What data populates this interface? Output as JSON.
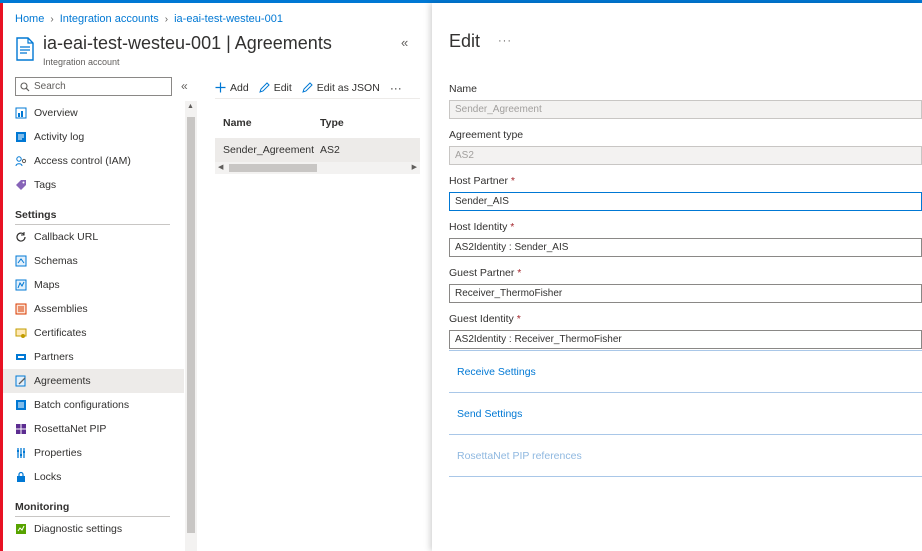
{
  "breadcrumb": [
    "Home",
    "Integration accounts",
    "ia-eai-test-westeu-001"
  ],
  "header": {
    "title": "ia-eai-test-westeu-001 | Agreements",
    "subtitle": "Integration account"
  },
  "search": {
    "placeholder": "Search"
  },
  "menu": {
    "top_items": [
      {
        "label": "Overview",
        "icon": "overview-icon"
      },
      {
        "label": "Activity log",
        "icon": "activity-log-icon"
      },
      {
        "label": "Access control (IAM)",
        "icon": "people-icon"
      },
      {
        "label": "Tags",
        "icon": "tag-icon"
      }
    ],
    "settings_title": "Settings",
    "settings_items": [
      {
        "label": "Callback URL",
        "icon": "refresh-icon"
      },
      {
        "label": "Schemas",
        "icon": "schema-icon"
      },
      {
        "label": "Maps",
        "icon": "map-icon"
      },
      {
        "label": "Assemblies",
        "icon": "assembly-icon"
      },
      {
        "label": "Certificates",
        "icon": "certificate-icon"
      },
      {
        "label": "Partners",
        "icon": "partner-icon"
      },
      {
        "label": "Agreements",
        "icon": "agreement-icon"
      },
      {
        "label": "Batch configurations",
        "icon": "batch-icon"
      },
      {
        "label": "RosettaNet PIP",
        "icon": "rosettanet-icon"
      },
      {
        "label": "Properties",
        "icon": "properties-icon"
      },
      {
        "label": "Locks",
        "icon": "lock-icon"
      }
    ],
    "monitoring_title": "Monitoring",
    "monitoring_items": [
      {
        "label": "Diagnostic settings",
        "icon": "diagnostic-icon"
      }
    ],
    "active": "Agreements"
  },
  "toolbar": {
    "add": "Add",
    "edit": "Edit",
    "edit_json": "Edit as JSON",
    "more": "···"
  },
  "grid": {
    "headers": [
      "Name",
      "Type"
    ],
    "rows": [
      [
        "Sender_Agreement",
        "AS2"
      ]
    ]
  },
  "edit": {
    "title": "Edit",
    "more": "···",
    "fields": [
      {
        "label": "Name",
        "value": "Sender_Agreement",
        "required": false,
        "state": "disabled"
      },
      {
        "label": "Agreement type",
        "value": "AS2",
        "required": false,
        "state": "disabled"
      },
      {
        "label": "Host Partner",
        "value": "Sender_AIS",
        "required": true,
        "state": "focused"
      },
      {
        "label": "Host Identity",
        "value": "AS2Identity : Sender_AIS",
        "required": true,
        "state": "normal"
      },
      {
        "label": "Guest Partner",
        "value": "Receiver_ThermoFisher",
        "required": true,
        "state": "normal"
      },
      {
        "label": "Guest Identity",
        "value": "AS2Identity : Receiver_ThermoFisher",
        "required": true,
        "state": "normal"
      }
    ],
    "sections": [
      {
        "label": "Receive Settings",
        "enabled": true
      },
      {
        "label": "Send Settings",
        "enabled": true
      },
      {
        "label": "RosettaNet PIP references",
        "enabled": false
      }
    ]
  },
  "colors": {
    "accent": "#0078d4",
    "required": "#a4262c",
    "active_bg": "#edebe9"
  }
}
